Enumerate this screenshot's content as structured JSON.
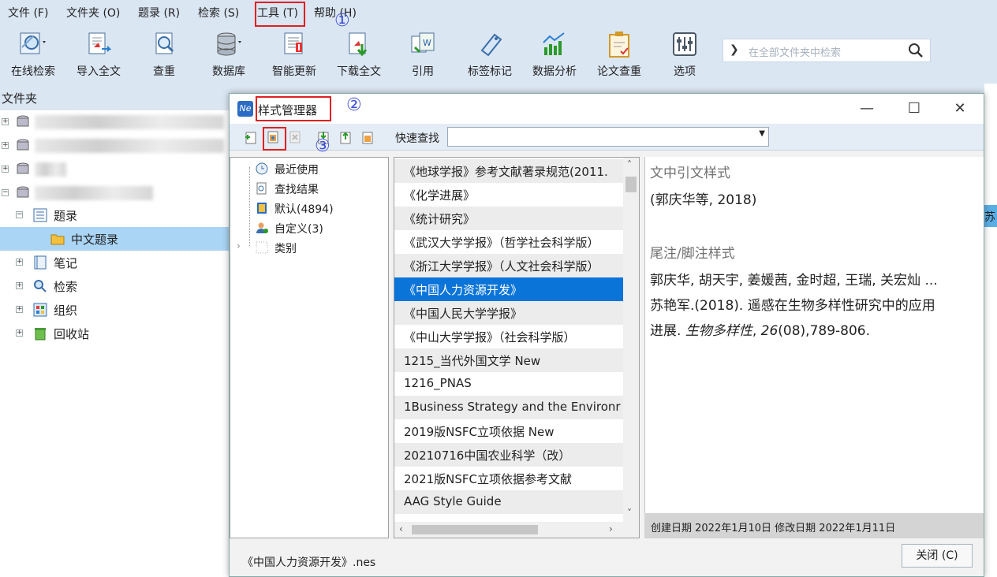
{
  "menu": {
    "items": [
      "文件 (F)",
      "文件夹 (O)",
      "题录 (R)",
      "检索 (S)",
      "工具 (T)",
      "帮助 (H)"
    ]
  },
  "annotations": {
    "a1": "①",
    "a2": "②",
    "a3": "③"
  },
  "toolbar": {
    "buttons": [
      "在线检索",
      "导入全文",
      "查重",
      "数据库",
      "智能更新",
      "下载全文",
      "引用",
      "标签标记",
      "数据分析",
      "论文查重",
      "选项"
    ],
    "search_placeholder": "在全部文件夹中检索"
  },
  "left_panel": {
    "header": "文件夹",
    "tree": [
      "题录",
      "中文题录",
      "笔记",
      "检索",
      "组织",
      "回收站"
    ]
  },
  "right_edge": {
    "fragment": "苏"
  },
  "dialog": {
    "title": "样式管理器",
    "quick_search_label": "快速查找",
    "categories": [
      "最近使用",
      "查找结果",
      "默认(4894)",
      "自定义(3)",
      "类别"
    ],
    "styles": [
      "《地球学报》参考文献著录规范(2011.",
      "《化学进展》",
      "《统计研究》",
      "《武汉大学学报》（哲学社会科学版）",
      "《浙江大学学报》（人文社会科学版）",
      "《中国人力资源开发》",
      "《中国人民大学学报》",
      "《中山大学学报》（社会科学版）",
      "1215_当代外国文学 New",
      "1216_PNAS",
      "1Business Strategy and the Environr",
      "2019版NSFC立项依据 New",
      "20210716中国农业科学（改）",
      "2021版NSFC立项依据参考文献",
      "AAG Style Guide"
    ],
    "preview": {
      "intext_heading": "文中引文样式",
      "intext_example": "(郭庆华等, 2018)",
      "footnote_heading": "尾注/脚注样式",
      "footnote_line1": "郭庆华, 胡天宇, 姜媛茜, 金时超, 王瑞, 关宏灿 ...",
      "footnote_line2": "苏艳军.(2018). 遥感在生物多样性研究中的应用",
      "footnote_line3_pre": "进展. ",
      "footnote_journal": "生物多样性",
      "footnote_sep": ", ",
      "footnote_volume": "26",
      "footnote_rest": "(08),789-806.",
      "footer": "创建日期  2022年1月10日   修改日期  2022年1月11日"
    },
    "status_file": "《中国人力资源开发》.nes",
    "close_label": "关闭 (C)"
  }
}
